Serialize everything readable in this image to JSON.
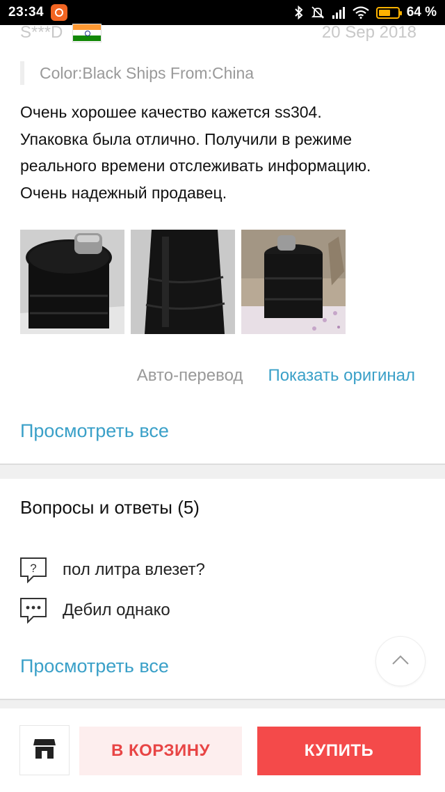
{
  "status_bar": {
    "time": "23:34",
    "battery_percent": "64 %",
    "battery_level": 0.64,
    "icons": [
      "app-notification-icon",
      "bluetooth-icon",
      "mute-icon",
      "signal-icon",
      "wifi-icon",
      "battery-icon"
    ]
  },
  "review": {
    "reviewer": "S***D",
    "country_flag": "india-flag-icon",
    "date": "20 Sep 2018",
    "properties": "Color:Black Ships From:China",
    "text_lines": [
      "Очень хорошее качество кажется ss304.",
      "Упаковка была отлично. Получили в режиме",
      "реального времени отслеживать информацию.",
      "Очень надежный продавец."
    ],
    "photos": [
      "photo-flask-top",
      "photo-flask-side",
      "photo-flask-table"
    ],
    "auto_translate": "Авто-перевод",
    "show_original": "Показать оригинал",
    "view_all": "Просмотреть все"
  },
  "qa": {
    "title": "Вопросы и ответы (5)",
    "question": "пол литра влезет?",
    "answer": "Дебил однако",
    "view_all": "Просмотреть все"
  },
  "bottom_bar": {
    "add_to_cart": "В КОРЗИНУ",
    "buy": "КУПИТЬ"
  },
  "colors": {
    "accent_link": "#3aa0c8",
    "buy_red": "#f44a4a",
    "cart_bg": "#fdeeee",
    "cart_text": "#e84545"
  }
}
